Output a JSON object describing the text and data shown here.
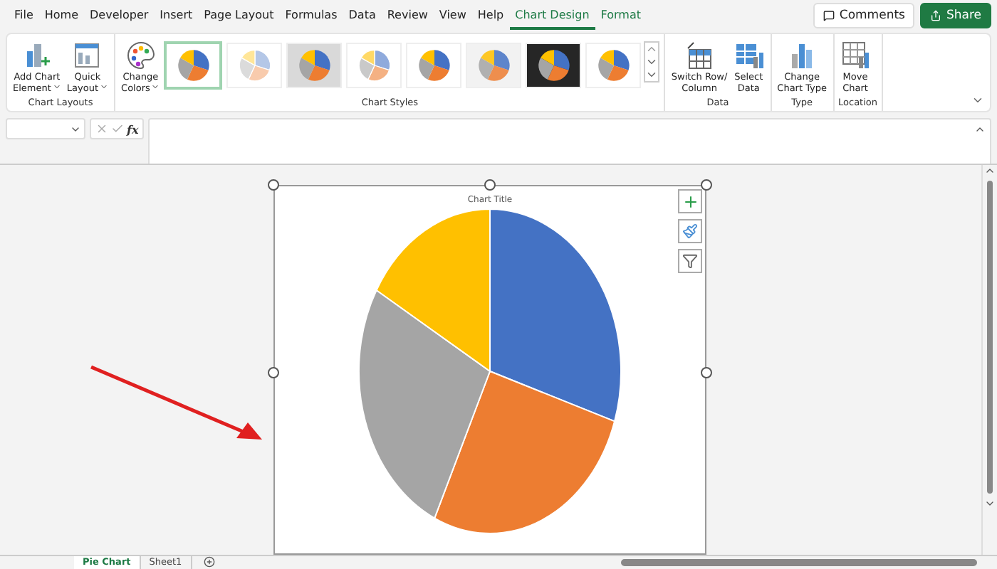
{
  "menu_tabs": [
    {
      "label": "File",
      "selected": false
    },
    {
      "label": "Home",
      "selected": false
    },
    {
      "label": "Developer",
      "selected": false
    },
    {
      "label": "Insert",
      "selected": false
    },
    {
      "label": "Page Layout",
      "selected": false
    },
    {
      "label": "Formulas",
      "selected": false
    },
    {
      "label": "Data",
      "selected": false
    },
    {
      "label": "Review",
      "selected": false
    },
    {
      "label": "View",
      "selected": false
    },
    {
      "label": "Help",
      "selected": false
    },
    {
      "label": "Chart Design",
      "selected": true
    },
    {
      "label": "Format",
      "selected": false,
      "contextual": true
    }
  ],
  "header_buttons": [
    {
      "label": "Comments",
      "kind": "comments"
    },
    {
      "label": "Share",
      "kind": "share"
    }
  ],
  "ribbon_groups": [
    {
      "label": "Chart Layouts",
      "kind": "buttons",
      "buttons": [
        {
          "lines": [
            "Add Chart",
            "Element"
          ],
          "dropdown": true
        },
        {
          "lines": [
            "Quick",
            "Layout"
          ],
          "dropdown": true
        }
      ]
    },
    {
      "label": "Chart Styles",
      "kind": "styles",
      "buttons": [
        {
          "lines": [
            "Change",
            "Colors"
          ],
          "dropdown": true
        }
      ],
      "styles": [
        {
          "kind": "standard",
          "selected": true
        },
        {
          "kind": "hatched",
          "selected": false
        },
        {
          "kind": "shaded",
          "selected": false
        },
        {
          "kind": "pastel",
          "selected": false
        },
        {
          "kind": "standard",
          "selected": false
        },
        {
          "kind": "faded",
          "selected": false
        },
        {
          "kind": "dark",
          "selected": false
        },
        {
          "kind": "standard",
          "selected": false
        }
      ]
    },
    {
      "label": "Data",
      "kind": "buttons",
      "buttons": [
        {
          "lines": [
            "Switch Row/",
            "Column"
          ],
          "dropdown": false
        },
        {
          "lines": [
            "Select",
            "Data"
          ],
          "dropdown": false
        }
      ]
    },
    {
      "label": "Type",
      "kind": "buttons",
      "buttons": [
        {
          "lines": [
            "Change",
            "Chart Type"
          ],
          "dropdown": false
        }
      ]
    },
    {
      "label": "Location",
      "kind": "buttons",
      "buttons": [
        {
          "lines": [
            "Move",
            "Chart"
          ],
          "dropdown": false
        }
      ]
    }
  ],
  "formula_bar": {
    "function_label": "fx"
  },
  "chart": {
    "title": "Chart Title",
    "selected": true
  },
  "sheet_tabs": [
    {
      "label": "Pie Chart",
      "selected": true
    },
    {
      "label": "Sheet1",
      "selected": false
    }
  ]
}
